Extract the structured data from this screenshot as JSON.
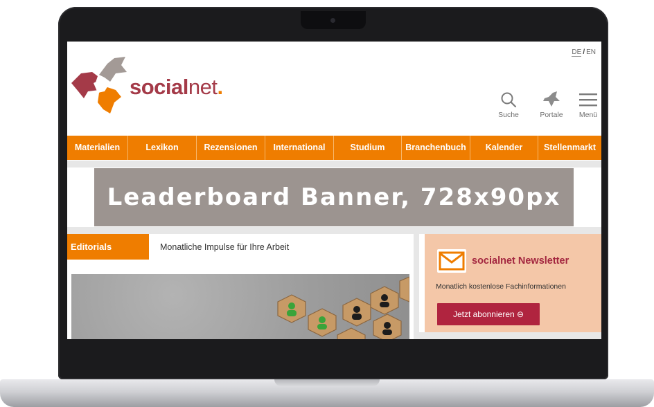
{
  "header": {
    "lang": {
      "de": "DE",
      "separator": "/",
      "en": "EN"
    },
    "logo": {
      "brand_bold": "social",
      "brand_light": "net",
      "brand_dot": "."
    },
    "icons": [
      {
        "name": "search-icon",
        "label": "Suche"
      },
      {
        "name": "portal-icon",
        "label": "Portale"
      },
      {
        "name": "menu-icon",
        "label": "Menü"
      }
    ]
  },
  "nav": {
    "items": [
      "Materialien",
      "Lexikon",
      "Rezensionen",
      "International",
      "Studium",
      "Branchenbuch",
      "Kalender",
      "Stellenmarkt"
    ]
  },
  "banner": {
    "text": "Leaderboard Banner, 728x90px"
  },
  "editorials": {
    "tag": "Editorials",
    "subtitle": "Monatliche Impulse für Ihre Arbeit"
  },
  "newsletter": {
    "title": "socialnet Newsletter",
    "text": "Monatlich kostenlose Fachinformationen",
    "button": "Jetzt abonnieren ⊖"
  },
  "colors": {
    "orange": "#ef7d00",
    "crimson": "#b0243f",
    "banner_grey": "#9c9490",
    "newsletter_bg": "#f4c7a8"
  }
}
